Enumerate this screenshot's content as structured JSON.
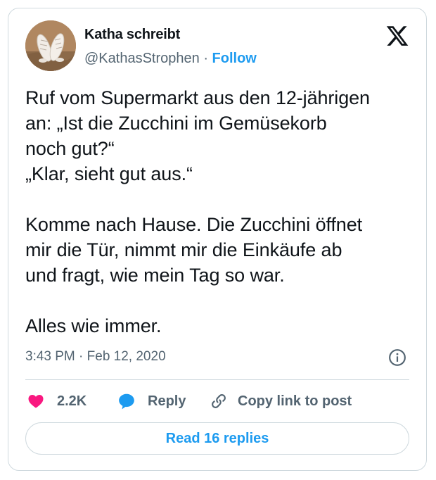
{
  "author": {
    "name": "Katha schreibt",
    "handle": "@KathasStrophen",
    "separator": "·",
    "follow_label": "Follow"
  },
  "tweet": {
    "text": "Ruf vom Supermarkt aus den 12-jährigen\nan: „Ist die Zucchini im Gemüsekorb\nnoch gut?“\n„Klar, sieht gut aus.“\n\nKomme nach Hause. Die Zucchini öffnet\nmir die Tür, nimmt mir die Einkäufe ab\nund fragt, wie mein Tag so war.\n\nAlles wie immer.",
    "time": "3:43 PM",
    "date_separator": "·",
    "date": "Feb 12, 2020"
  },
  "actions": {
    "like_count": "2.2K",
    "reply_label": "Reply",
    "copy_label": "Copy link to post"
  },
  "footer": {
    "read_replies_label": "Read 16 replies"
  },
  "icons": {
    "logo": "x-logo-icon",
    "info": "info-icon",
    "like": "heart-icon",
    "reply": "speech-bubble-icon",
    "copy": "link-icon"
  },
  "colors": {
    "accent": "#1d9bf0",
    "like": "#f91880",
    "secondary_text": "#536471",
    "border": "#cfd9de"
  }
}
